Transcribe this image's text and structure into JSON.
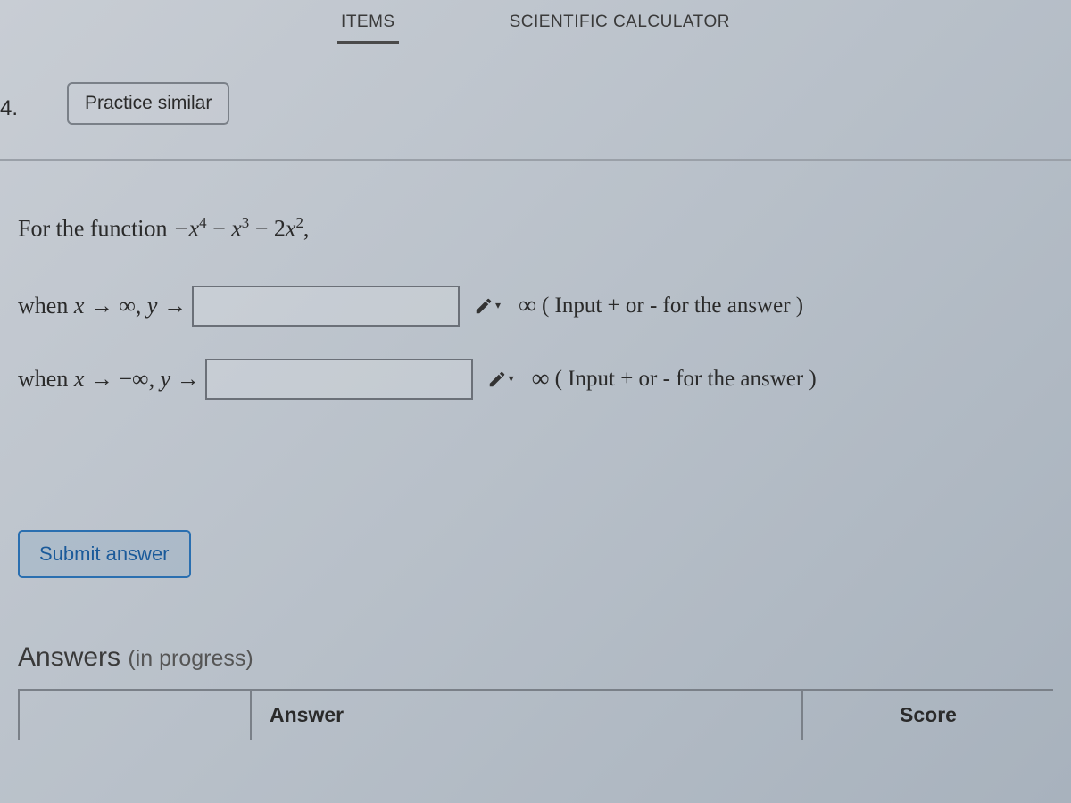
{
  "topbar": {
    "items_tab": "ITEMS",
    "calc_tab": "SCIENTIFIC CALCULATOR"
  },
  "question_number": "4.",
  "practice_button": "Practice similar",
  "prompt_prefix": "For the function ",
  "expression_plain": "−x⁴ − x³ − 2x²,",
  "rows": [
    {
      "lead_prefix": "when ",
      "lead_math": "x → ∞, y →",
      "value": "",
      "infinity": "∞",
      "hint": "( Input + or - for the answer )"
    },
    {
      "lead_prefix": "when ",
      "lead_math": "x → −∞, y →",
      "value": "",
      "infinity": "∞",
      "hint": "( Input + or - for the answer )"
    }
  ],
  "submit_label": "Submit answer",
  "answers_section": {
    "heading": "Answers",
    "status": "(in progress)",
    "col_blank": "",
    "col_answer": "Answer",
    "col_score": "Score"
  }
}
